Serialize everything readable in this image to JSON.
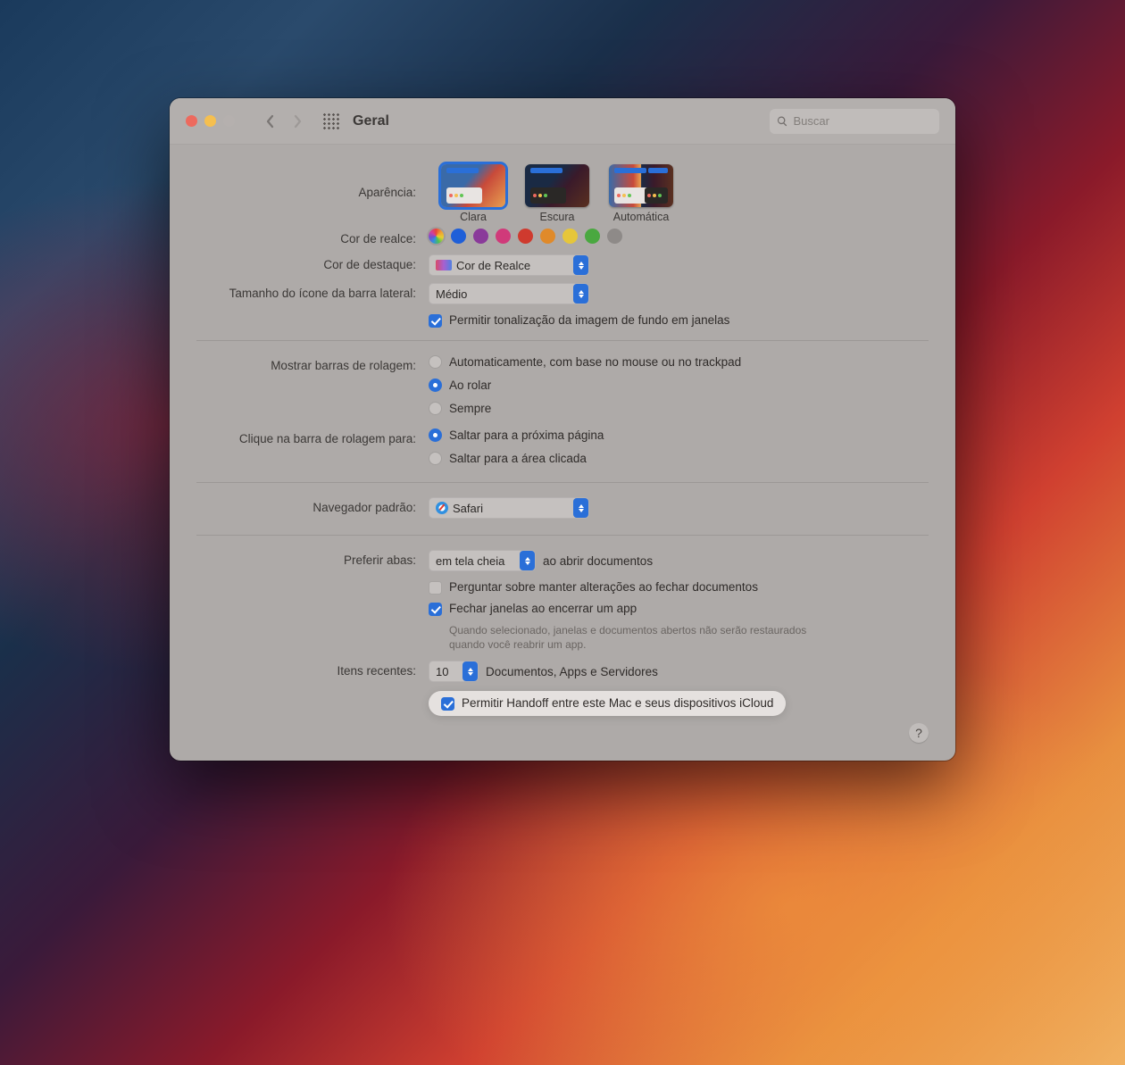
{
  "window": {
    "title": "Geral",
    "search_placeholder": "Buscar"
  },
  "appearance": {
    "label": "Aparência:",
    "options": {
      "light": "Clara",
      "dark": "Escura",
      "auto": "Automática"
    },
    "selected": "light"
  },
  "accent": {
    "label": "Cor de realce:",
    "colors": [
      "multi",
      "#1f5fd8",
      "#8a3a9a",
      "#d03a7a",
      "#cf3a2e",
      "#e08a2a",
      "#e6c63a",
      "#4aa840",
      "gray"
    ]
  },
  "highlight": {
    "label": "Cor de destaque:",
    "value": "Cor de Realce"
  },
  "sidebar_icon": {
    "label": "Tamanho do ícone da barra lateral:",
    "value": "Médio"
  },
  "tint": {
    "label": "Permitir tonalização da imagem de fundo em janelas",
    "checked": true
  },
  "scrollbars": {
    "label": "Mostrar barras de rolagem:",
    "options": {
      "auto": "Automaticamente, com base no mouse ou no trackpad",
      "scrolling": "Ao rolar",
      "always": "Sempre"
    },
    "selected": "scrolling"
  },
  "scroll_click": {
    "label": "Clique na barra de rolagem para:",
    "options": {
      "next_page": "Saltar para a próxima página",
      "clicked_spot": "Saltar para a área clicada"
    },
    "selected": "next_page"
  },
  "browser": {
    "label": "Navegador padrão:",
    "value": "Safari"
  },
  "tabs": {
    "label": "Preferir abas:",
    "value": "em tela cheia",
    "suffix": "ao abrir documentos"
  },
  "ask_keep": {
    "label": "Perguntar sobre manter alterações ao fechar documentos",
    "checked": false
  },
  "close_windows": {
    "label": "Fechar janelas ao encerrar um app",
    "desc": "Quando selecionado, janelas e documentos abertos não serão restaurados quando você reabrir um app.",
    "checked": true
  },
  "recents": {
    "label": "Itens recentes:",
    "value": "10",
    "suffix": "Documentos, Apps e Servidores"
  },
  "handoff": {
    "label": "Permitir Handoff entre este Mac e seus dispositivos iCloud",
    "checked": true
  }
}
